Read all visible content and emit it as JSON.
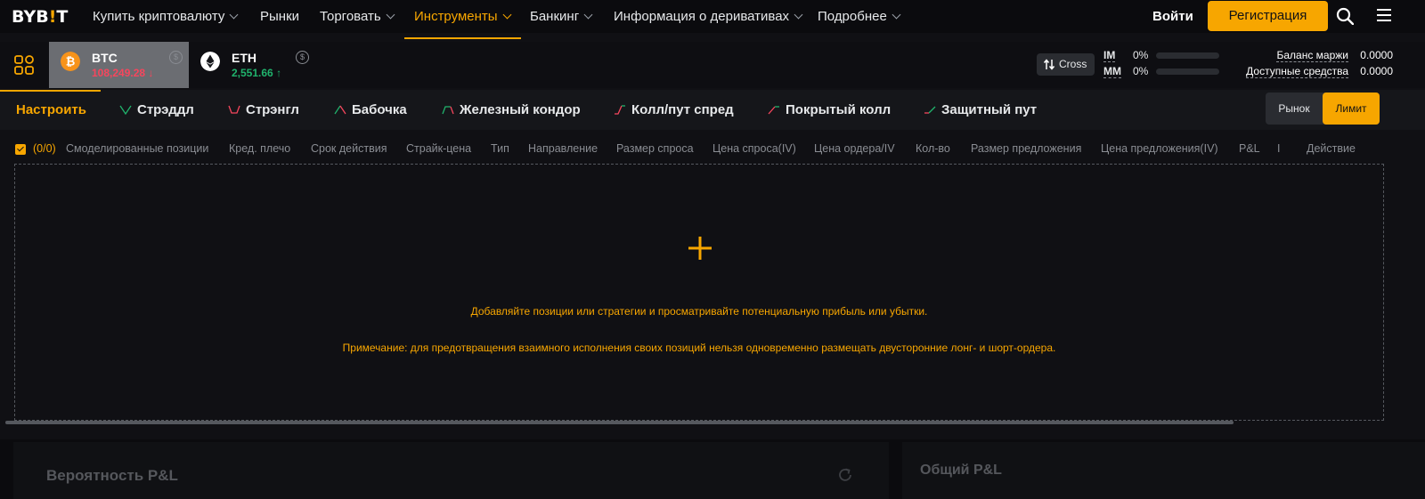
{
  "nav": {
    "logo_text": "BYB",
    "logo_bar": "!",
    "logo_tail": "T",
    "items": [
      {
        "label": "Купить криптовалюту",
        "dropdown": true
      },
      {
        "label": "Рынки",
        "dropdown": false
      },
      {
        "label": "Торговать",
        "dropdown": true
      },
      {
        "label": "Инструменты",
        "dropdown": true,
        "active": true
      },
      {
        "label": "Банкинг",
        "dropdown": true
      },
      {
        "label": "Информация о деривативах",
        "dropdown": true
      },
      {
        "label": "Подробнее",
        "dropdown": true
      }
    ],
    "login": "Войти",
    "register": "Регистрация",
    "accent": "#f7a600"
  },
  "coins": [
    {
      "name": "BTC",
      "price": "108,249.28",
      "direction": "down",
      "color": "#f6465d",
      "icon": "bitcoin-icon",
      "selected": true
    },
    {
      "name": "ETH",
      "price": "2,551.66",
      "direction": "up",
      "color": "#20b26c",
      "icon": "ethereum-icon",
      "selected": false
    }
  ],
  "margin": {
    "mode": "Cross",
    "im_label": "IM",
    "im_value": "0%",
    "mm_label": "MM",
    "mm_value": "0%",
    "balance_label": "Баланс маржи",
    "balance_value": "0.0000",
    "available_label": "Доступные средства",
    "available_value": "0.0000"
  },
  "strategies": [
    {
      "label": "Настроить",
      "active": true
    },
    {
      "label": "Стрэддл",
      "icon": "straddle-icon"
    },
    {
      "label": "Стрэнгл",
      "icon": "strangle-icon"
    },
    {
      "label": "Бабочка",
      "icon": "butterfly-icon"
    },
    {
      "label": "Железный кондор",
      "icon": "iron-condor-icon"
    },
    {
      "label": "Колл/пут спред",
      "icon": "call-put-spread-icon"
    },
    {
      "label": "Покрытый колл",
      "icon": "covered-call-icon"
    },
    {
      "label": "Защитный пут",
      "icon": "protective-put-icon"
    }
  ],
  "order_type": {
    "market": "Рынок",
    "limit": "Лимит",
    "selected": "limit"
  },
  "table": {
    "count": "(0/0)",
    "columns": [
      "Смоделированные позиции",
      "Кред. плечо",
      "Срок действия",
      "Страйк-цена",
      "Тип",
      "Направление",
      "Размер спроса",
      "Цена спроса(IV)",
      "Цена ордера/IV",
      "Кол-во",
      "Размер предложения",
      "Цена предложения(IV)",
      "P&L",
      "I",
      "Действие"
    ]
  },
  "empty": {
    "message": "Добавляйте позиции или стратегии и просматривайте потенциальную прибыль или убытки.",
    "note": "Примечание: для предотвращения взаимного исполнения своих позиций нельзя одновременно размещать двусторонние лонг- и шорт-ордера."
  },
  "panels": {
    "probability_title": "Вероятность P&L",
    "total_title": "Общий P&L"
  }
}
